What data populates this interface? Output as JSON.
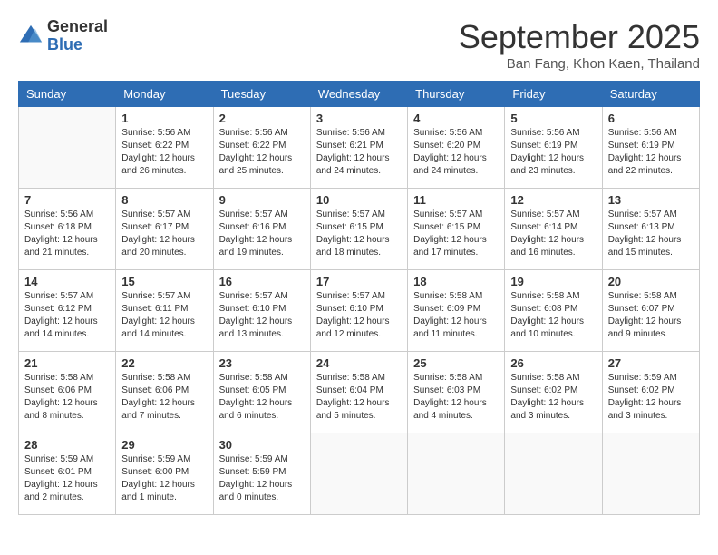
{
  "logo": {
    "general": "General",
    "blue": "Blue"
  },
  "header": {
    "month": "September 2025",
    "location": "Ban Fang, Khon Kaen, Thailand"
  },
  "weekdays": [
    "Sunday",
    "Monday",
    "Tuesday",
    "Wednesday",
    "Thursday",
    "Friday",
    "Saturday"
  ],
  "weeks": [
    [
      {
        "day": "",
        "sunrise": "",
        "sunset": "",
        "daylight": ""
      },
      {
        "day": "1",
        "sunrise": "Sunrise: 5:56 AM",
        "sunset": "Sunset: 6:22 PM",
        "daylight": "Daylight: 12 hours and 26 minutes."
      },
      {
        "day": "2",
        "sunrise": "Sunrise: 5:56 AM",
        "sunset": "Sunset: 6:22 PM",
        "daylight": "Daylight: 12 hours and 25 minutes."
      },
      {
        "day": "3",
        "sunrise": "Sunrise: 5:56 AM",
        "sunset": "Sunset: 6:21 PM",
        "daylight": "Daylight: 12 hours and 24 minutes."
      },
      {
        "day": "4",
        "sunrise": "Sunrise: 5:56 AM",
        "sunset": "Sunset: 6:20 PM",
        "daylight": "Daylight: 12 hours and 24 minutes."
      },
      {
        "day": "5",
        "sunrise": "Sunrise: 5:56 AM",
        "sunset": "Sunset: 6:19 PM",
        "daylight": "Daylight: 12 hours and 23 minutes."
      },
      {
        "day": "6",
        "sunrise": "Sunrise: 5:56 AM",
        "sunset": "Sunset: 6:19 PM",
        "daylight": "Daylight: 12 hours and 22 minutes."
      }
    ],
    [
      {
        "day": "7",
        "sunrise": "Sunrise: 5:56 AM",
        "sunset": "Sunset: 6:18 PM",
        "daylight": "Daylight: 12 hours and 21 minutes."
      },
      {
        "day": "8",
        "sunrise": "Sunrise: 5:57 AM",
        "sunset": "Sunset: 6:17 PM",
        "daylight": "Daylight: 12 hours and 20 minutes."
      },
      {
        "day": "9",
        "sunrise": "Sunrise: 5:57 AM",
        "sunset": "Sunset: 6:16 PM",
        "daylight": "Daylight: 12 hours and 19 minutes."
      },
      {
        "day": "10",
        "sunrise": "Sunrise: 5:57 AM",
        "sunset": "Sunset: 6:15 PM",
        "daylight": "Daylight: 12 hours and 18 minutes."
      },
      {
        "day": "11",
        "sunrise": "Sunrise: 5:57 AM",
        "sunset": "Sunset: 6:15 PM",
        "daylight": "Daylight: 12 hours and 17 minutes."
      },
      {
        "day": "12",
        "sunrise": "Sunrise: 5:57 AM",
        "sunset": "Sunset: 6:14 PM",
        "daylight": "Daylight: 12 hours and 16 minutes."
      },
      {
        "day": "13",
        "sunrise": "Sunrise: 5:57 AM",
        "sunset": "Sunset: 6:13 PM",
        "daylight": "Daylight: 12 hours and 15 minutes."
      }
    ],
    [
      {
        "day": "14",
        "sunrise": "Sunrise: 5:57 AM",
        "sunset": "Sunset: 6:12 PM",
        "daylight": "Daylight: 12 hours and 14 minutes."
      },
      {
        "day": "15",
        "sunrise": "Sunrise: 5:57 AM",
        "sunset": "Sunset: 6:11 PM",
        "daylight": "Daylight: 12 hours and 14 minutes."
      },
      {
        "day": "16",
        "sunrise": "Sunrise: 5:57 AM",
        "sunset": "Sunset: 6:10 PM",
        "daylight": "Daylight: 12 hours and 13 minutes."
      },
      {
        "day": "17",
        "sunrise": "Sunrise: 5:57 AM",
        "sunset": "Sunset: 6:10 PM",
        "daylight": "Daylight: 12 hours and 12 minutes."
      },
      {
        "day": "18",
        "sunrise": "Sunrise: 5:58 AM",
        "sunset": "Sunset: 6:09 PM",
        "daylight": "Daylight: 12 hours and 11 minutes."
      },
      {
        "day": "19",
        "sunrise": "Sunrise: 5:58 AM",
        "sunset": "Sunset: 6:08 PM",
        "daylight": "Daylight: 12 hours and 10 minutes."
      },
      {
        "day": "20",
        "sunrise": "Sunrise: 5:58 AM",
        "sunset": "Sunset: 6:07 PM",
        "daylight": "Daylight: 12 hours and 9 minutes."
      }
    ],
    [
      {
        "day": "21",
        "sunrise": "Sunrise: 5:58 AM",
        "sunset": "Sunset: 6:06 PM",
        "daylight": "Daylight: 12 hours and 8 minutes."
      },
      {
        "day": "22",
        "sunrise": "Sunrise: 5:58 AM",
        "sunset": "Sunset: 6:06 PM",
        "daylight": "Daylight: 12 hours and 7 minutes."
      },
      {
        "day": "23",
        "sunrise": "Sunrise: 5:58 AM",
        "sunset": "Sunset: 6:05 PM",
        "daylight": "Daylight: 12 hours and 6 minutes."
      },
      {
        "day": "24",
        "sunrise": "Sunrise: 5:58 AM",
        "sunset": "Sunset: 6:04 PM",
        "daylight": "Daylight: 12 hours and 5 minutes."
      },
      {
        "day": "25",
        "sunrise": "Sunrise: 5:58 AM",
        "sunset": "Sunset: 6:03 PM",
        "daylight": "Daylight: 12 hours and 4 minutes."
      },
      {
        "day": "26",
        "sunrise": "Sunrise: 5:58 AM",
        "sunset": "Sunset: 6:02 PM",
        "daylight": "Daylight: 12 hours and 3 minutes."
      },
      {
        "day": "27",
        "sunrise": "Sunrise: 5:59 AM",
        "sunset": "Sunset: 6:02 PM",
        "daylight": "Daylight: 12 hours and 3 minutes."
      }
    ],
    [
      {
        "day": "28",
        "sunrise": "Sunrise: 5:59 AM",
        "sunset": "Sunset: 6:01 PM",
        "daylight": "Daylight: 12 hours and 2 minutes."
      },
      {
        "day": "29",
        "sunrise": "Sunrise: 5:59 AM",
        "sunset": "Sunset: 6:00 PM",
        "daylight": "Daylight: 12 hours and 1 minute."
      },
      {
        "day": "30",
        "sunrise": "Sunrise: 5:59 AM",
        "sunset": "Sunset: 5:59 PM",
        "daylight": "Daylight: 12 hours and 0 minutes."
      },
      {
        "day": "",
        "sunrise": "",
        "sunset": "",
        "daylight": ""
      },
      {
        "day": "",
        "sunrise": "",
        "sunset": "",
        "daylight": ""
      },
      {
        "day": "",
        "sunrise": "",
        "sunset": "",
        "daylight": ""
      },
      {
        "day": "",
        "sunrise": "",
        "sunset": "",
        "daylight": ""
      }
    ]
  ]
}
